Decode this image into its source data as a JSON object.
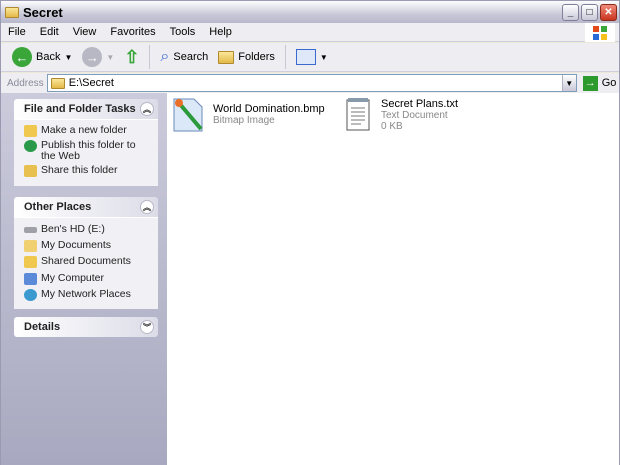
{
  "window": {
    "title": "Secret"
  },
  "menu": [
    "File",
    "Edit",
    "View",
    "Favorites",
    "Tools",
    "Help"
  ],
  "toolbar": {
    "back": "Back",
    "search": "Search",
    "folders": "Folders"
  },
  "address": {
    "label": "Address",
    "value": "E:\\Secret",
    "go": "Go"
  },
  "tasks": {
    "title": "File and Folder Tasks",
    "items": [
      "Make a new folder",
      "Publish this folder to the Web",
      "Share this folder"
    ]
  },
  "places": {
    "title": "Other Places",
    "items": [
      "Ben's HD (E:)",
      "My Documents",
      "Shared Documents",
      "My Computer",
      "My Network Places"
    ]
  },
  "details": {
    "title": "Details"
  },
  "files": [
    {
      "name": "World Domination.bmp",
      "type": "Bitmap Image"
    },
    {
      "name": "Secret Plans.txt",
      "type": "Text Document",
      "size": "0 KB"
    }
  ]
}
